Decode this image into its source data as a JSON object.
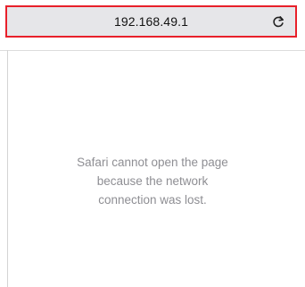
{
  "address_bar": {
    "url": "192.168.49.1"
  },
  "page": {
    "error_message": "Safari cannot open the page\nbecause the network\nconnection was lost."
  },
  "icons": {
    "reload": "reload-icon"
  },
  "colors": {
    "highlight_border": "#e8202a",
    "address_bar_bg": "#e6e6e9",
    "message_text": "#8e8e93"
  }
}
